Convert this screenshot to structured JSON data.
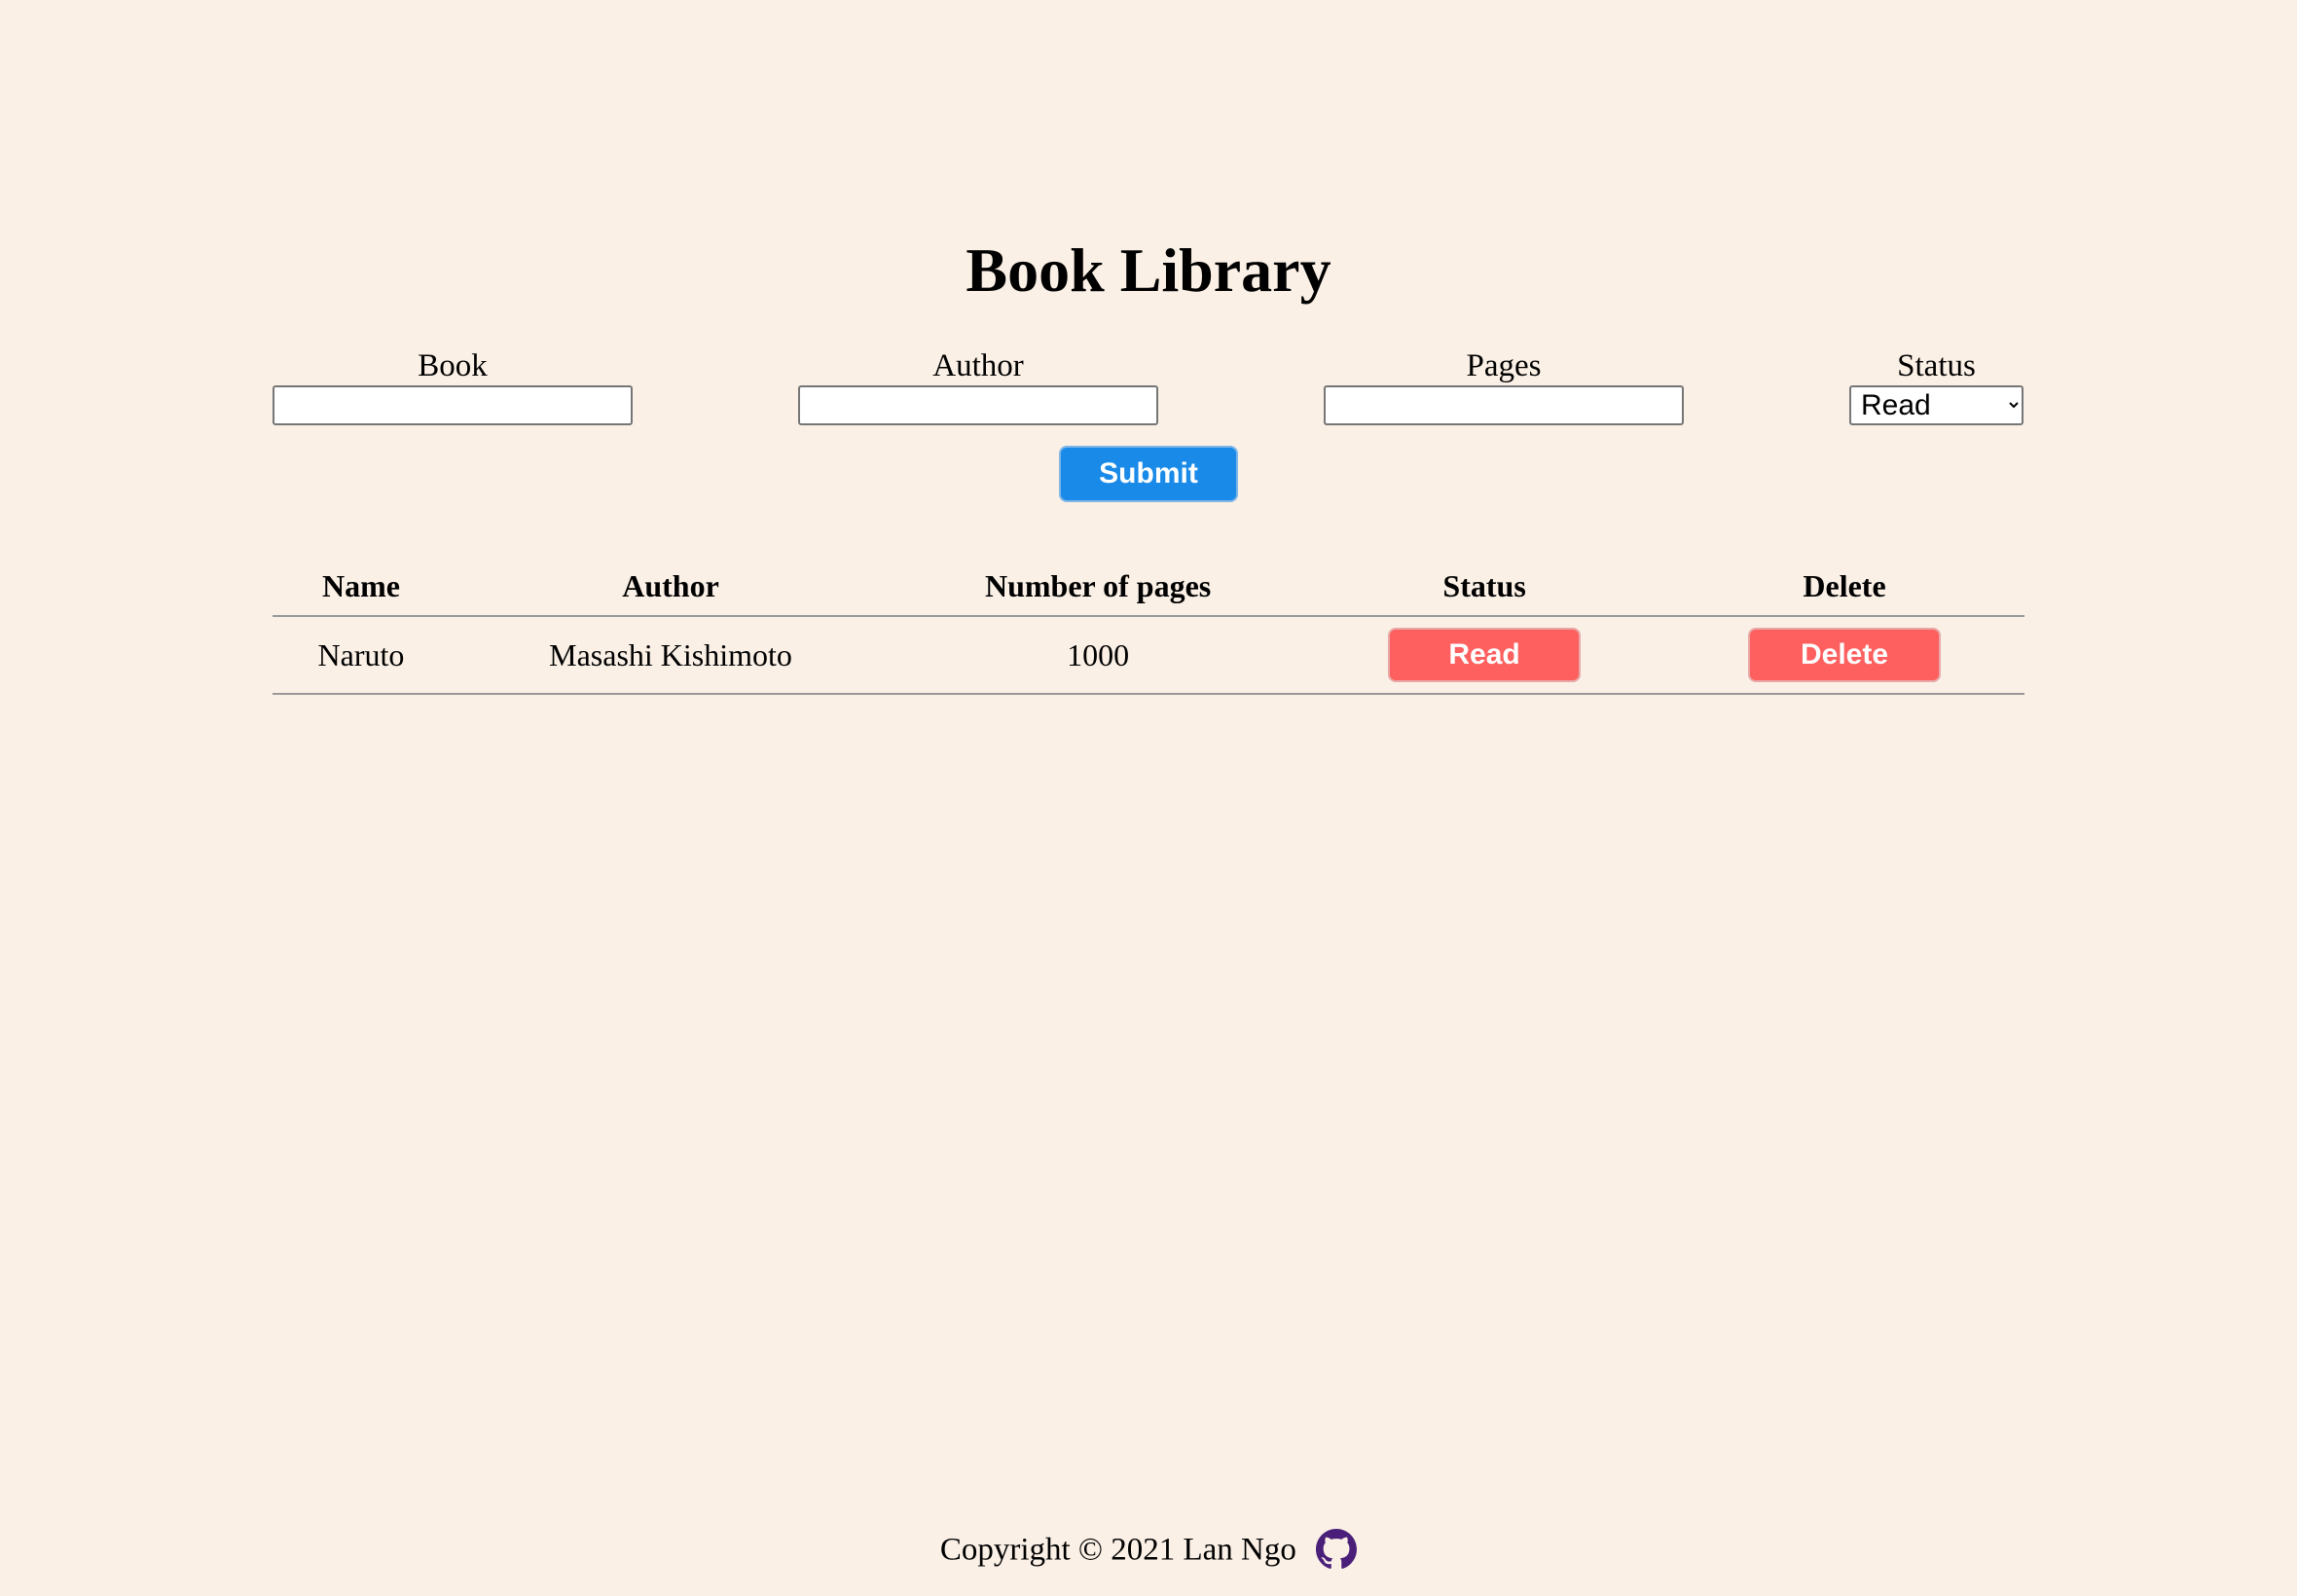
{
  "page": {
    "title": "Book Library"
  },
  "form": {
    "book_label": "Book",
    "book_value": "",
    "author_label": "Author",
    "author_value": "",
    "pages_label": "Pages",
    "pages_value": "",
    "status_label": "Status",
    "status_selected": "Read",
    "submit_label": "Submit"
  },
  "table": {
    "headers": [
      "Name",
      "Author",
      "Number of pages",
      "Status",
      "Delete"
    ],
    "rows": [
      {
        "name": "Naruto",
        "author": "Masashi Kishimoto",
        "pages": "1000",
        "status_button": "Read",
        "delete_button": "Delete"
      }
    ]
  },
  "footer": {
    "copyright": "Copyright © 2021 Lan Ngo",
    "icon": "github-icon"
  },
  "colors": {
    "background": "#faf0e6",
    "submit_button": "#198ae8",
    "row_button": "#fe5f5f",
    "github_icon": "#4a1f7a"
  }
}
